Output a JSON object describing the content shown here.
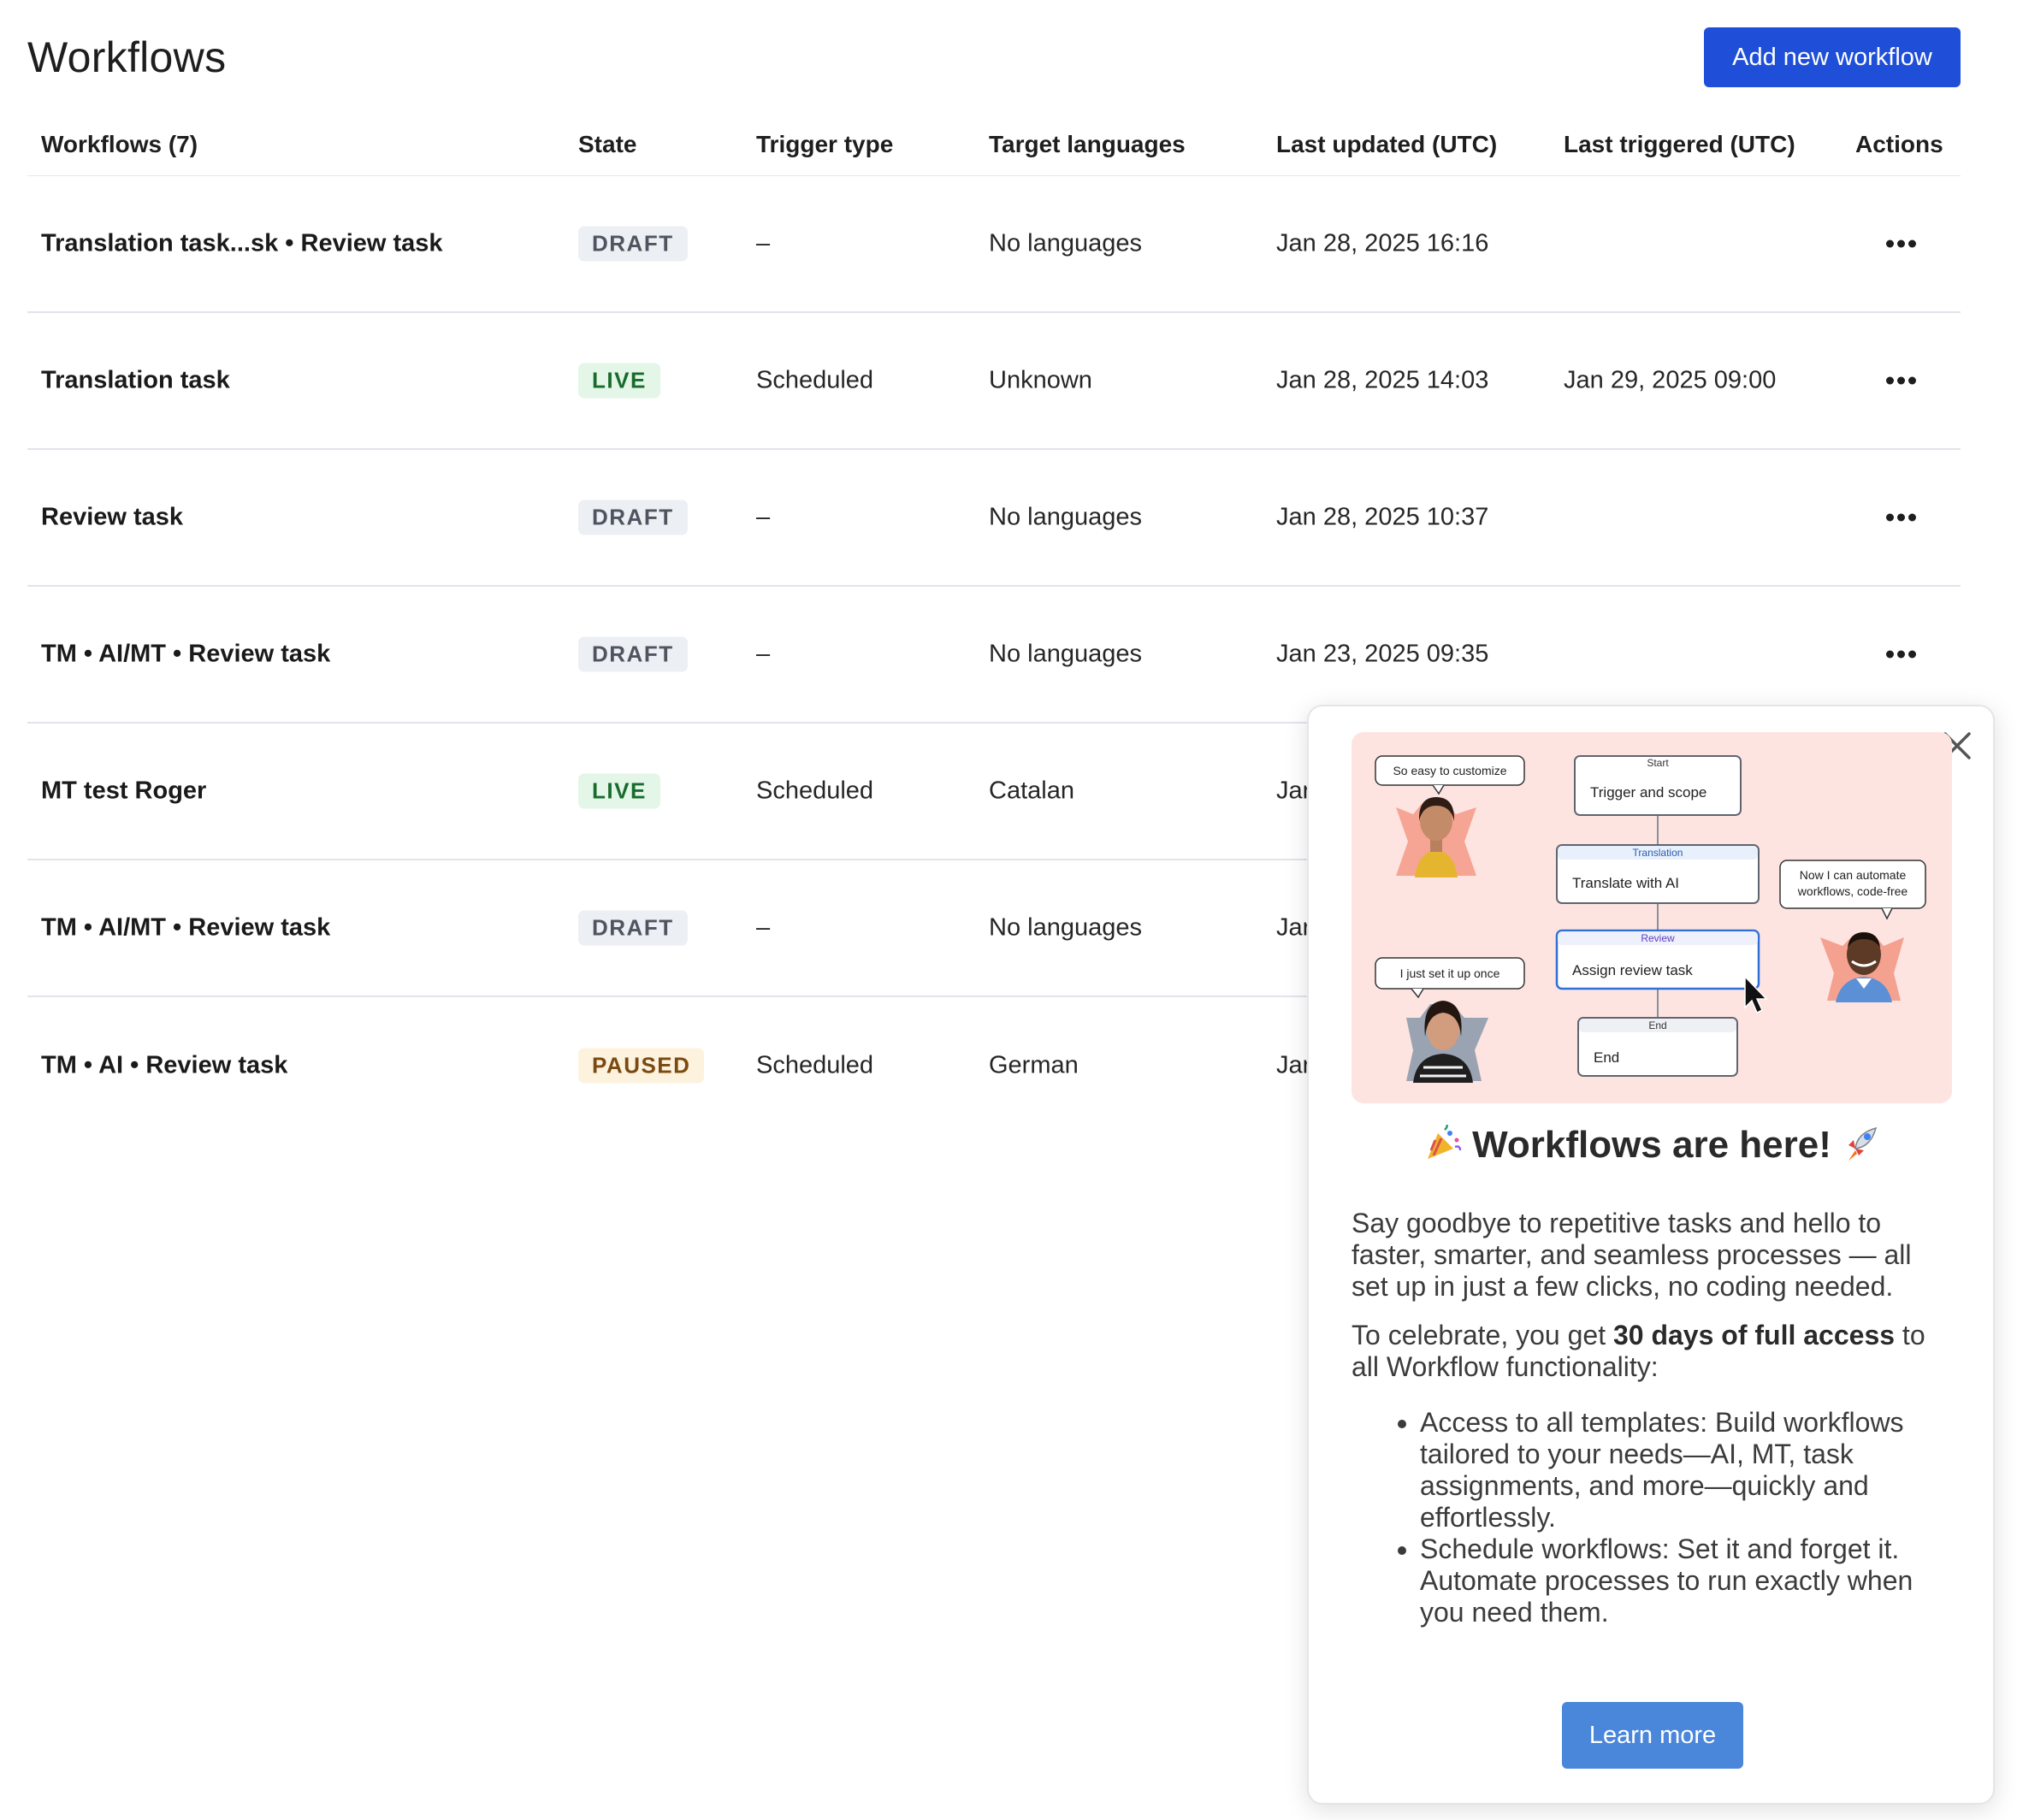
{
  "page": {
    "title": "Workflows",
    "add_button": "Add new workflow"
  },
  "table": {
    "headers": {
      "name": "Workflows (7)",
      "state": "State",
      "trigger": "Trigger type",
      "languages": "Target languages",
      "updated": "Last updated (UTC)",
      "triggered": "Last triggered (UTC)",
      "actions": "Actions"
    },
    "rows": [
      {
        "name": "Translation task...sk • Review task",
        "state": "DRAFT",
        "trigger": "–",
        "languages": "No languages",
        "updated": "Jan 28, 2025 16:16",
        "triggered": ""
      },
      {
        "name": "Translation task",
        "state": "LIVE",
        "trigger": "Scheduled",
        "languages": "Unknown",
        "updated": "Jan 28, 2025 14:03",
        "triggered": "Jan 29, 2025 09:00"
      },
      {
        "name": "Review task",
        "state": "DRAFT",
        "trigger": "–",
        "languages": "No languages",
        "updated": "Jan 28, 2025 10:37",
        "triggered": ""
      },
      {
        "name": "TM • AI/MT • Review task",
        "state": "DRAFT",
        "trigger": "–",
        "languages": "No languages",
        "updated": "Jan 23, 2025 09:35",
        "triggered": ""
      },
      {
        "name": "MT test Roger",
        "state": "LIVE",
        "trigger": "Scheduled",
        "languages": "Catalan",
        "updated": "Jar",
        "triggered": ""
      },
      {
        "name": "TM • AI/MT • Review task",
        "state": "DRAFT",
        "trigger": "–",
        "languages": "No languages",
        "updated": "Jar",
        "triggered": ""
      },
      {
        "name": "TM • AI • Review task",
        "state": "PAUSED",
        "trigger": "Scheduled",
        "languages": "German",
        "updated": "Jar",
        "triggered": ""
      }
    ]
  },
  "popup": {
    "illustration": {
      "bubble_1": "So easy to customize",
      "bubble_2": "I just set it up once",
      "bubble_3_line1": "Now I can automate",
      "bubble_3_line2": "workflows, code-free",
      "start_label": "Start",
      "start_text": "Trigger and scope",
      "translation_label": "Translation",
      "translation_text": "Translate with AI",
      "review_label": "Review",
      "review_text": "Assign review task",
      "end_label": "End",
      "end_text": "End"
    },
    "title": "Workflows are here!",
    "title_emoji_left": "party-popper-icon",
    "title_emoji_right": "rocket-icon",
    "para1": "Say goodbye to repetitive tasks and hello to faster, smarter, and seamless processes — all set up in just a few clicks, no coding needed.",
    "para2_prefix": "To celebrate, you get ",
    "para2_bold": "30 days of full access",
    "para2_suffix": " to all Workflow functionality:",
    "bullets": [
      "Access to all templates: Build workflows tailored to your needs—AI, MT, task assignments, and more—quickly and effortlessly.",
      "Schedule workflows: Set it and forget it. Automate processes to run exactly when you need them."
    ],
    "learn_more": "Learn more"
  },
  "colors": {
    "primary": "#1f4fd8",
    "learn_more": "#4a86d9",
    "draft_bg": "#eceff3",
    "live_bg": "#e4f6e7",
    "paused_bg": "#fdf2de",
    "hero_bg": "#fde4e1"
  }
}
